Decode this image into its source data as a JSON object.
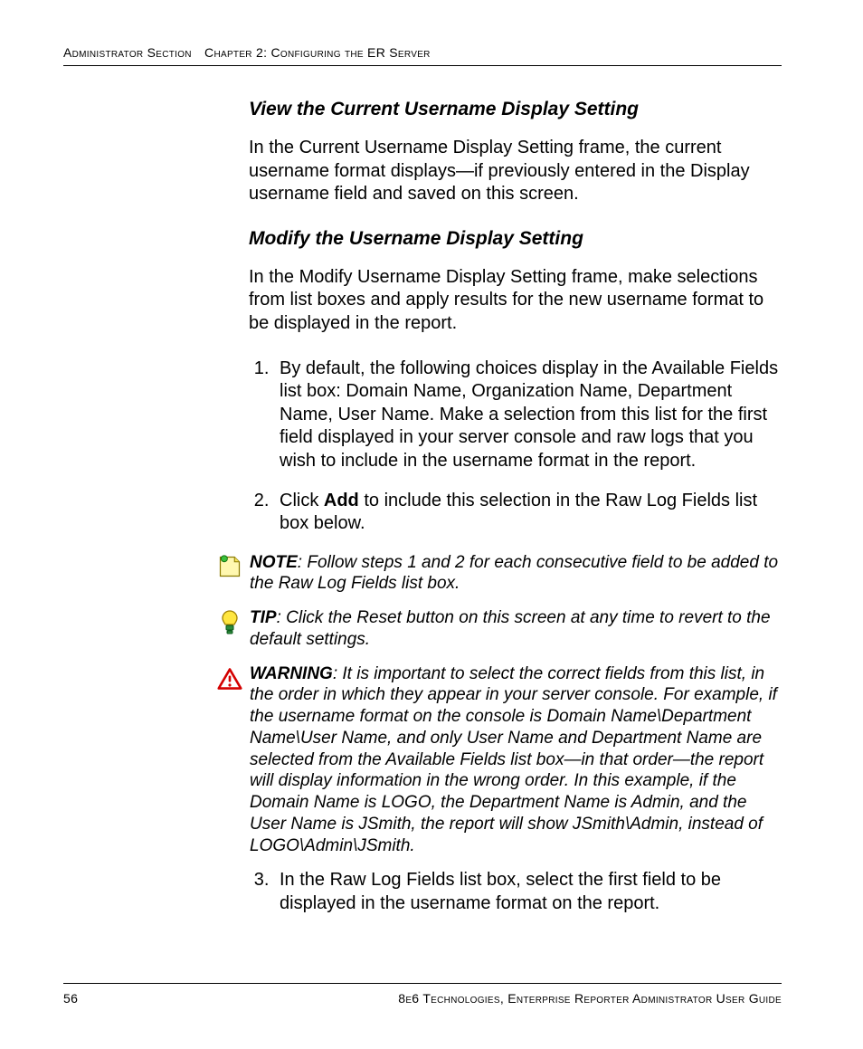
{
  "header": {
    "section": "Administrator Section",
    "chapter": "Chapter 2: Configuring the ER Server"
  },
  "sections": {
    "view": {
      "title": "View the Current Username Display Setting",
      "para": "In the Current Username Display Setting frame, the current username format displays—if previously entered in the Display username field and saved on this screen."
    },
    "modify": {
      "title": "Modify the Username Display Setting",
      "para": "In the Modify Username Display Setting frame, make selections from list boxes and apply results for the new username format to be displayed in the report.",
      "step1": "By default, the following choices display in the Available Fields list box: Domain Name, Organization Name, Department Name, User Name. Make a selection from this list for the first field displayed in your server console and raw logs that you wish to include in the username format in the report.",
      "step2_pre": "Click ",
      "step2_bold": "Add",
      "step2_post": " to include this selection in the Raw Log Fields list box below.",
      "step3": "In the Raw Log Fields list box, select the first field to be displayed in the username format on the report."
    }
  },
  "callouts": {
    "note": {
      "lead": "NOTE",
      "text": ": Follow steps 1 and 2 for each consecutive field to be added to the Raw Log Fields list box."
    },
    "tip": {
      "lead": "TIP",
      "text": ": Click the Reset button on this screen at any time to revert to the default settings."
    },
    "warning": {
      "lead": "WARNING",
      "text": ": It is important to select the correct fields from this list, in the order in which they appear in your server console. For example, if the username format on the console is Domain Name\\Department Name\\User Name, and only User Name and Department Name are selected from the Available Fields list box—in that order—the report will display information in the wrong order. In this example, if the Domain Name is LOGO, the Department Name is Admin, and the User Name is JSmith, the report will show JSmith\\Admin, instead of LOGO\\Admin\\JSmith."
    }
  },
  "footer": {
    "page": "56",
    "line": "8e6 Technologies, Enterprise Reporter Administrator User Guide"
  }
}
